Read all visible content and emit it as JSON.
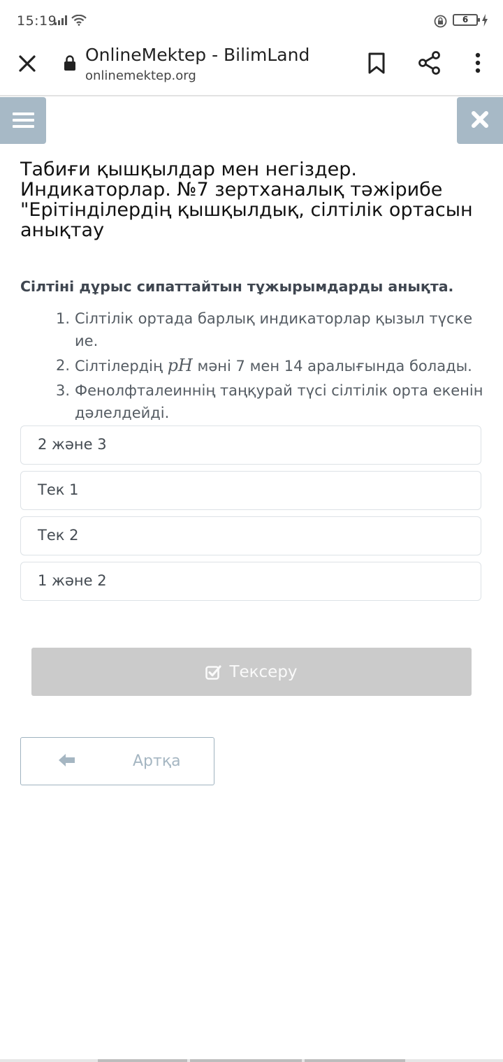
{
  "status_bar": {
    "time": "15:19",
    "battery": "6"
  },
  "browser": {
    "page_title": "OnlineMektep - BilimLand",
    "url": "onlinemektep.org"
  },
  "lesson": {
    "title": "Табиғи қышқылдар мен негіздер. Индикаторлар. №7 зертханалық тәжірибе \"Ерітінділердің қышқылдық, сілтілік ортасын анықтау"
  },
  "question": {
    "prompt": "Сілтіні дұрыс сипаттайтын тұжырымдарды анықта.",
    "statements": [
      {
        "num": "1.",
        "text": "Сілтілік ортада барлық индикаторлар қызыл түске ие."
      },
      {
        "num": "2.",
        "pre": "Сілтілердің ",
        "math": "pH",
        "post": " мәні 7 мен 14 аралығында болады."
      },
      {
        "num": "3.",
        "text": "Фенолфталеиннің таңқурай түсі сілтілік орта екенін дәлелдейді."
      }
    ]
  },
  "options": [
    {
      "label": "2 және 3"
    },
    {
      "label": "Тек 1"
    },
    {
      "label": "Тек 2"
    },
    {
      "label": "1 және 2"
    }
  ],
  "actions": {
    "check_label": "Тексеру",
    "back_label": "Артқа"
  },
  "colors": {
    "side_button": "#a7b9c6",
    "check_button": "#cbcbcb",
    "back_border": "#9fb2bf"
  },
  "icons": {
    "menu": "hamburger-icon",
    "close": "close-icon",
    "check": "checkbox-check-icon",
    "back": "arrow-left-icon"
  }
}
